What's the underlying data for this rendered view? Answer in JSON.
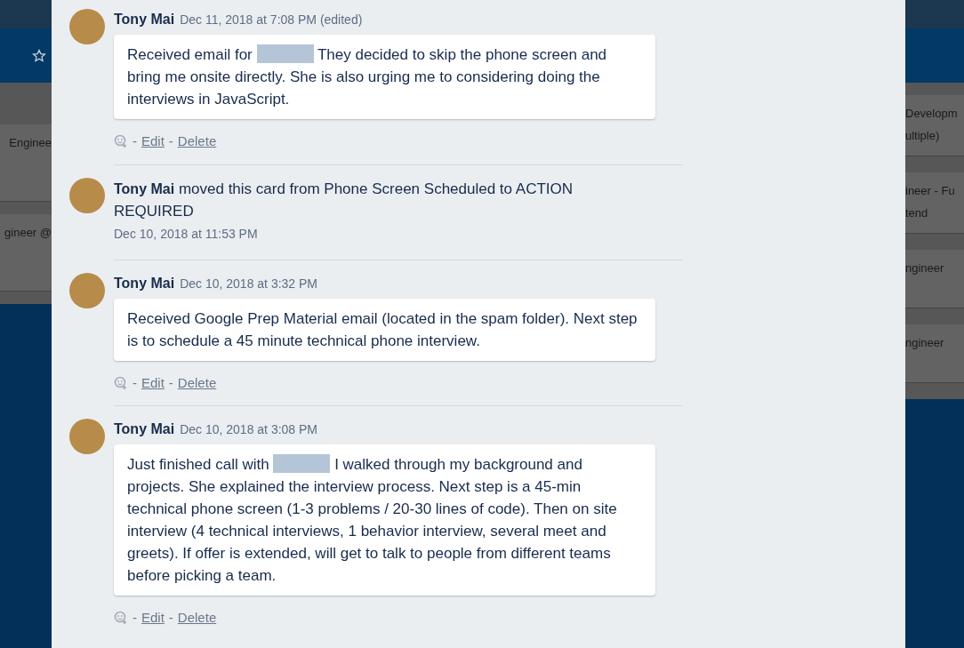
{
  "board_left": {
    "cards": [
      "Enginee",
      "gineer @"
    ]
  },
  "board_right": {
    "cards": [
      [
        "Developm",
        "ultiple)"
      ],
      [
        "ineer - Fu",
        "tend"
      ],
      [
        "ngineer"
      ],
      [
        "ngineer"
      ]
    ]
  },
  "activity": [
    {
      "kind": "comment",
      "author": "Tony Mai",
      "time": "Dec 11, 2018 at 7:08 PM (edited)",
      "text": [
        {
          "kind": "text",
          "value": "Received email for "
        },
        {
          "kind": "redacted"
        },
        {
          "kind": "text",
          "value": " They decided to skip the phone screen and bring me onsite directly. She is also urging me to considering doing the interviews in JavaScript."
        }
      ],
      "actions": [
        "-",
        "Edit",
        "-",
        "Delete"
      ]
    },
    {
      "kind": "action",
      "author": "Tony Mai",
      "message": "moved this card from Phone Screen Scheduled to ACTION REQUIRED",
      "time": "Dec 10, 2018 at 11:53 PM"
    },
    {
      "kind": "comment",
      "author": "Tony Mai",
      "time": "Dec 10, 2018 at 3:32 PM",
      "text": [
        {
          "kind": "text",
          "value": "Received Google Prep Material email (located in the spam folder). Next step is to schedule a 45 minute technical phone interview."
        }
      ],
      "actions": [
        "-",
        "Edit",
        "-",
        "Delete"
      ]
    },
    {
      "kind": "comment",
      "author": "Tony Mai",
      "time": "Dec 10, 2018 at 3:08 PM",
      "text": [
        {
          "kind": "text",
          "value": "Just finished call with "
        },
        {
          "kind": "redacted"
        },
        {
          "kind": "text",
          "value": " I walked through my background and projects. She explained the interview process. Next step is a 45-min technical phone screen (1-3 problems / 20-30 lines of code). Then on site interview (4 technical interviews, 1 behavior interview, several meet and greets). If offer is extended, will get to talk to people from different teams before picking a team."
        }
      ],
      "actions": [
        "-",
        "Edit",
        "-",
        "Delete"
      ]
    }
  ]
}
